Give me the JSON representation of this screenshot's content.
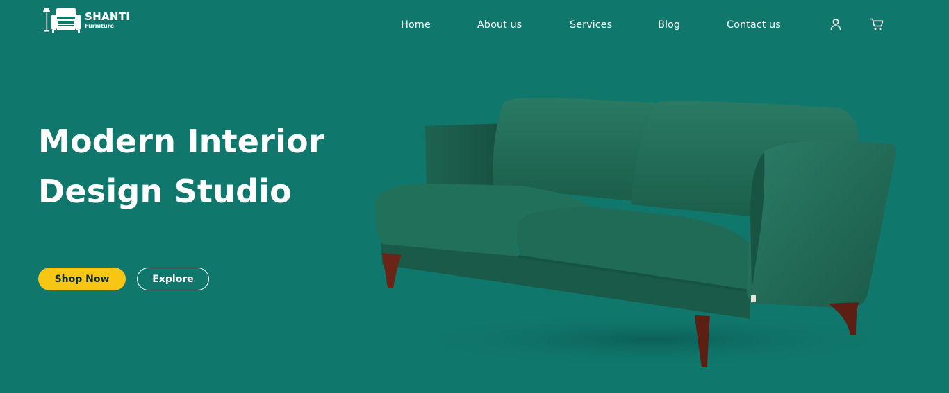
{
  "brand": {
    "name": "SHANTI",
    "tagline": "Furniture"
  },
  "nav": {
    "links": [
      {
        "label": "Home"
      },
      {
        "label": "About us"
      },
      {
        "label": "Services"
      },
      {
        "label": "Blog"
      },
      {
        "label": "Contact us"
      }
    ],
    "icons": [
      "user-icon",
      "cart-icon"
    ]
  },
  "hero": {
    "title_line1": "Modern Interior",
    "title_line2": "Design Studio",
    "primary_button": "Shop Now",
    "secondary_button": "Explore",
    "image": "green-velvet-sofa"
  },
  "colors": {
    "background": "#10776d",
    "accent": "#f7c614",
    "text": "#ffffff",
    "sofa": "#1f6b55"
  }
}
